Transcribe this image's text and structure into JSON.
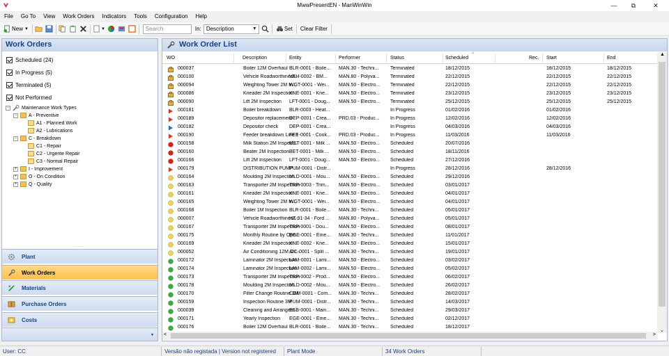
{
  "window": {
    "title": "MwwPresentEN - ManWinWin",
    "min": "—",
    "max": "⧉",
    "close": "✕"
  },
  "menu": [
    "File",
    "Go To",
    "View",
    "Work Orders",
    "Indicators",
    "Tools",
    "Configuration",
    "Help"
  ],
  "toolbar": {
    "new_label": "New",
    "search_placeholder": "Search",
    "in_label": "In:",
    "in_value": "Description",
    "set_label": "Set",
    "clear_filter_label": "Clear Filter"
  },
  "left": {
    "title": "Work Orders",
    "filters": [
      "Scheduled (24)",
      "In Progress (5)",
      "Terminated (5)",
      "Not Performed"
    ],
    "tree": [
      {
        "label": "Maintenance Work Types",
        "level": 0,
        "kind": "root"
      },
      {
        "label": "A - Preventive",
        "level": 1,
        "kind": "folder"
      },
      {
        "label": "A1 - Planned Work",
        "level": 2,
        "kind": "leaf"
      },
      {
        "label": "A2 - Lubrications",
        "level": 2,
        "kind": "leaf"
      },
      {
        "label": "C - Breakdown",
        "level": 1,
        "kind": "folder"
      },
      {
        "label": "C1 - Repair",
        "level": 2,
        "kind": "leaf"
      },
      {
        "label": "C2 - Urgente Repair",
        "level": 2,
        "kind": "leaf"
      },
      {
        "label": "C3 - Normal Repair",
        "level": 2,
        "kind": "leaf"
      },
      {
        "label": "I - Improvement",
        "level": 1,
        "kind": "folder"
      },
      {
        "label": "O - On Condition",
        "level": 1,
        "kind": "folder"
      },
      {
        "label": "Q - Quality",
        "level": 1,
        "kind": "folder"
      }
    ],
    "nav": [
      "Plant",
      "Work Orders",
      "Materials",
      "Purchase Orders",
      "Costs"
    ]
  },
  "main": {
    "title": "Work Order List",
    "columns": [
      "WO",
      "Description",
      "Entity",
      "Performer",
      "Status",
      "Scheduled",
      "Rec.",
      "Start",
      "End"
    ],
    "rows": [
      [
        "terminated",
        "000037",
        "Boiler 12M Overhaul",
        "BLR-0001 - Boile...",
        "MAN.30 - Techni...",
        "Terminated",
        "18/12/2015",
        "",
        "18/12/2015",
        "18/12/2015"
      ],
      [
        "terminated",
        "000100",
        "Vehicle Roadworthiness...",
        "VEH-0002 - BM...",
        "MAN.80 - Polyva...",
        "Terminated",
        "22/12/2015",
        "",
        "22/12/2015",
        "22/12/2015"
      ],
      [
        "terminated",
        "000094",
        "Weighting Tower 2M In...",
        "WGT-0001 - Wei...",
        "MAN.50 - Electro...",
        "Terminated",
        "22/12/2015",
        "",
        "22/12/2015",
        "22/12/2015"
      ],
      [
        "terminated",
        "000086",
        "Kneader 2M Inspection",
        "KNE-0001 - Kne...",
        "MAN.50 - Electro...",
        "Terminated",
        "23/12/2015",
        "",
        "23/12/2015",
        "23/12/2015"
      ],
      [
        "terminated",
        "000090",
        "Lift 2M Inspection",
        "LFT-0001 - Doug...",
        "MAN.50 - Electro...",
        "Terminated",
        "25/12/2015",
        "",
        "25/12/2015",
        "25/12/2015"
      ],
      [
        "inprogress",
        "000181",
        "Boiler breakdown",
        "BLR-0003 - Heat...",
        "",
        "In Progress",
        "01/02/2016",
        "",
        "01/02/2016",
        ""
      ],
      [
        "inprogress",
        "000189",
        "Depositor replacement",
        "DEP-0001 - Crea...",
        "PRD.03 - Produc...",
        "In Progress",
        "12/02/2016",
        "",
        "12/02/2016",
        ""
      ],
      [
        "inprogress2",
        "000182",
        "Depositor check",
        "DEP-0001 - Crea...",
        "",
        "In Progress",
        "04/03/2016",
        "",
        "04/03/2016",
        ""
      ],
      [
        "inprogress",
        "000190",
        "Feeder breakdown Line 1",
        "FEE-0001 - Cook...",
        "PRD.03 - Produc...",
        "In Progress",
        "11/03/2016",
        "",
        "11/03/2016",
        ""
      ],
      [
        "red",
        "000158",
        "Milk Station 2M Inspecti...",
        "MST-0001 - Milk ...",
        "MAN.50 - Electro...",
        "Scheduled",
        "20/07/2016",
        "",
        "",
        ""
      ],
      [
        "red",
        "000160",
        "Beater 2M Inspection",
        "BET-0001 - Milk ...",
        "MAN.50 - Electro...",
        "Scheduled",
        "18/11/2016",
        "",
        "",
        ""
      ],
      [
        "red",
        "000166",
        "Lift 2M Inspection",
        "LFT-0001 - Doug...",
        "MAN.50 - Electro...",
        "Scheduled",
        "27/12/2016",
        "",
        "",
        ""
      ],
      [
        "inprogress",
        "000179",
        "DISTRIBUTION PUMP ...",
        "PUM-0001 - Distr...",
        "",
        "In Progress",
        "28/12/2016",
        "",
        "28/12/2016",
        ""
      ],
      [
        "yellow",
        "000164",
        "Moulding 2M Inspection",
        "MLD-0001 - Mou...",
        "MAN.50 - Electro...",
        "Scheduled",
        "29/12/2016",
        "",
        "",
        ""
      ],
      [
        "yellow",
        "000163",
        "Transporter 2M Inspection",
        "TRP-0003 - Trim...",
        "MAN.50 - Electro...",
        "Scheduled",
        "03/01/2017",
        "",
        "",
        ""
      ],
      [
        "yellow",
        "000161",
        "Kneader 2M Inspection",
        "KNE-0001 - Kne...",
        "MAN.50 - Electro...",
        "Scheduled",
        "04/01/2017",
        "",
        "",
        ""
      ],
      [
        "yellow",
        "000165",
        "Weighting Tower 2M In...",
        "WGT-0001 - Wei...",
        "MAN.50 - Electro...",
        "Scheduled",
        "04/01/2017",
        "",
        "",
        ""
      ],
      [
        "yellow",
        "000168",
        "Boiler 1M Inspection",
        "BLR-0001 - Boile...",
        "MAN.30 - Techni...",
        "Scheduled",
        "05/01/2017",
        "",
        "",
        ""
      ],
      [
        "yellow",
        "000007",
        "Vehicle Roadworthiness...",
        "HZ-91-34 - Ford ...",
        "MAN.80 - Polyva...",
        "Scheduled",
        "05/01/2017",
        "",
        "",
        ""
      ],
      [
        "yellow",
        "000167",
        "Transporter 2M Inspection",
        "TRP-0001 - Dou...",
        "MAN.50 - Electro...",
        "Scheduled",
        "08/01/2017",
        "",
        "",
        ""
      ],
      [
        "yellow",
        "000175",
        "Monthly Routine by Ope...",
        "EGE-0001 - Eme...",
        "MAN.30 - Techni...",
        "Scheduled",
        "11/01/2017",
        "",
        "",
        ""
      ],
      [
        "yellow",
        "000169",
        "Kneader 2M Inspection",
        "KNE-0002 - Kne...",
        "MAN.50 - Electro...",
        "Scheduled",
        "15/01/2017",
        "",
        "",
        ""
      ],
      [
        "yellow",
        "000052",
        "Air Conditioning 12M Ov...",
        "AIC-0001 - Split ...",
        "MAN.30 - Techni...",
        "Scheduled",
        "19/01/2017",
        "",
        "",
        ""
      ],
      [
        "green",
        "000172",
        "Laminator 2M Inspection",
        "LAM-0001 - Lami...",
        "MAN.50 - Electro...",
        "Scheduled",
        "03/02/2017",
        "",
        "",
        ""
      ],
      [
        "green",
        "000174",
        "Laminator 2M Inspection",
        "LAM-0002 - Lami...",
        "MAN.50 - Electro...",
        "Scheduled",
        "05/02/2017",
        "",
        "",
        ""
      ],
      [
        "green",
        "000173",
        "Transporter 2M Inspection",
        "TRP-0002 - Prod...",
        "MAN.50 - Electro...",
        "Scheduled",
        "06/02/2017",
        "",
        "",
        ""
      ],
      [
        "green",
        "000178",
        "Moulding 2M Inspection",
        "MLD-0002 - Mou...",
        "MAN.50 - Electro...",
        "Scheduled",
        "26/02/2017",
        "",
        "",
        ""
      ],
      [
        "green",
        "000170",
        "Filter Change Routine 3M",
        "COM-0001 - Com...",
        "MAN.30 - Techni...",
        "Scheduled",
        "28/02/2017",
        "",
        "",
        ""
      ],
      [
        "green",
        "000159",
        "Inspection Routine 3M",
        "PUM-0001 - Distr...",
        "MAN.30 - Techni...",
        "Scheduled",
        "14/03/2017",
        "",
        "",
        ""
      ],
      [
        "green",
        "000039",
        "Cleaning and Arrangem...",
        "ESB-0001 - Main...",
        "MAN.30 - Techni...",
        "Scheduled",
        "29/03/2017",
        "",
        "",
        ""
      ],
      [
        "green",
        "000171",
        "Yearly Inspection",
        "EGE-0001 - Eme...",
        "MAN.30 - Techni...",
        "Scheduled",
        "02/12/2017",
        "",
        "",
        ""
      ],
      [
        "green",
        "000176",
        "Boiler 12M Overhaul",
        "BLR-0001 - Boile...",
        "MAN.30 - Techni...",
        "Scheduled",
        "18/12/2017",
        "",
        "",
        ""
      ]
    ]
  },
  "status": {
    "user": "User: CC",
    "version": "Versão não registada | Version not registered",
    "mode": "Plant Mode",
    "count": "34 Work Orders"
  },
  "colors": {
    "terminated": "#e0b040",
    "inprogress": "#e8321e",
    "inprogress2": "#1e74d8",
    "red": "#e02010",
    "yellow": "#f3d24a",
    "green": "#2fb038",
    "header_text": "#15428b"
  }
}
